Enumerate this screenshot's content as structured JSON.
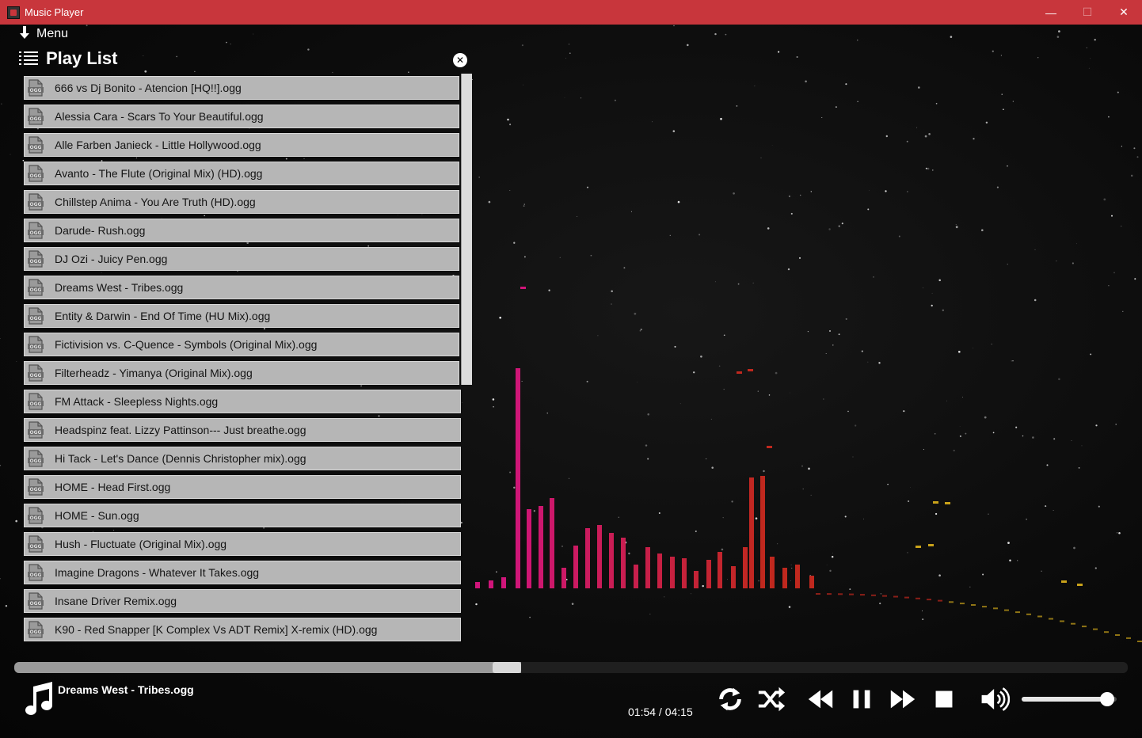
{
  "window": {
    "title": "Music Player",
    "minimize": "—",
    "maximize": "☐",
    "close": "✕"
  },
  "menu": {
    "label": "Menu"
  },
  "playlist": {
    "title": "Play List",
    "tracks": [
      "666 vs Dj Bonito - Atencion [HQ!!].ogg",
      "Alessia Cara - Scars To Your Beautiful.ogg",
      "Alle Farben  Janieck - Little Hollywood.ogg",
      "Avanto - The Flute (Original Mix) (HD).ogg",
      "Chillstep Anima - You Are Truth (HD).ogg",
      "Darude- Rush.ogg",
      "DJ Ozi - Juicy Pen.ogg",
      "Dreams West - Tribes.ogg",
      "Entity & Darwin - End Of Time (HU Mix).ogg",
      "Fictivision vs. C-Quence - Symbols (Original Mix).ogg",
      "Filterheadz - Yimanya (Original Mix).ogg",
      "FM Attack - Sleepless Nights.ogg",
      "Headspinz feat. Lizzy Pattinson--- Just breathe.ogg",
      "Hi Tack - Let's Dance (Dennis Christopher mix).ogg",
      "HOME - Head First.ogg",
      "HOME - Sun.ogg",
      "Hush - Fluctuate (Original Mix).ogg",
      "Imagine Dragons - Whatever It Takes.ogg",
      "Insane Driver Remix.ogg",
      "K90 - Red Snapper [K Complex Vs ADT Remix] X-remix (HD).ogg"
    ],
    "file_icon": "ogg-file-icon"
  },
  "player": {
    "now_playing": "Dreams West - Tribes.ogg",
    "time": "01:54 / 04:15",
    "progress": 0.455,
    "volume": 0.9
  },
  "controls": [
    "repeat-icon",
    "shuffle-icon",
    "rewind-icon",
    "pause-icon",
    "fast-forward-icon",
    "stop-icon",
    "volume-icon"
  ],
  "colors": {
    "titlebar": "#c8363c",
    "track_bg": "#b6b6b6",
    "viz_pink": "#d0157a",
    "viz_red": "#c0281e",
    "viz_yellow": "#c9a21a"
  }
}
